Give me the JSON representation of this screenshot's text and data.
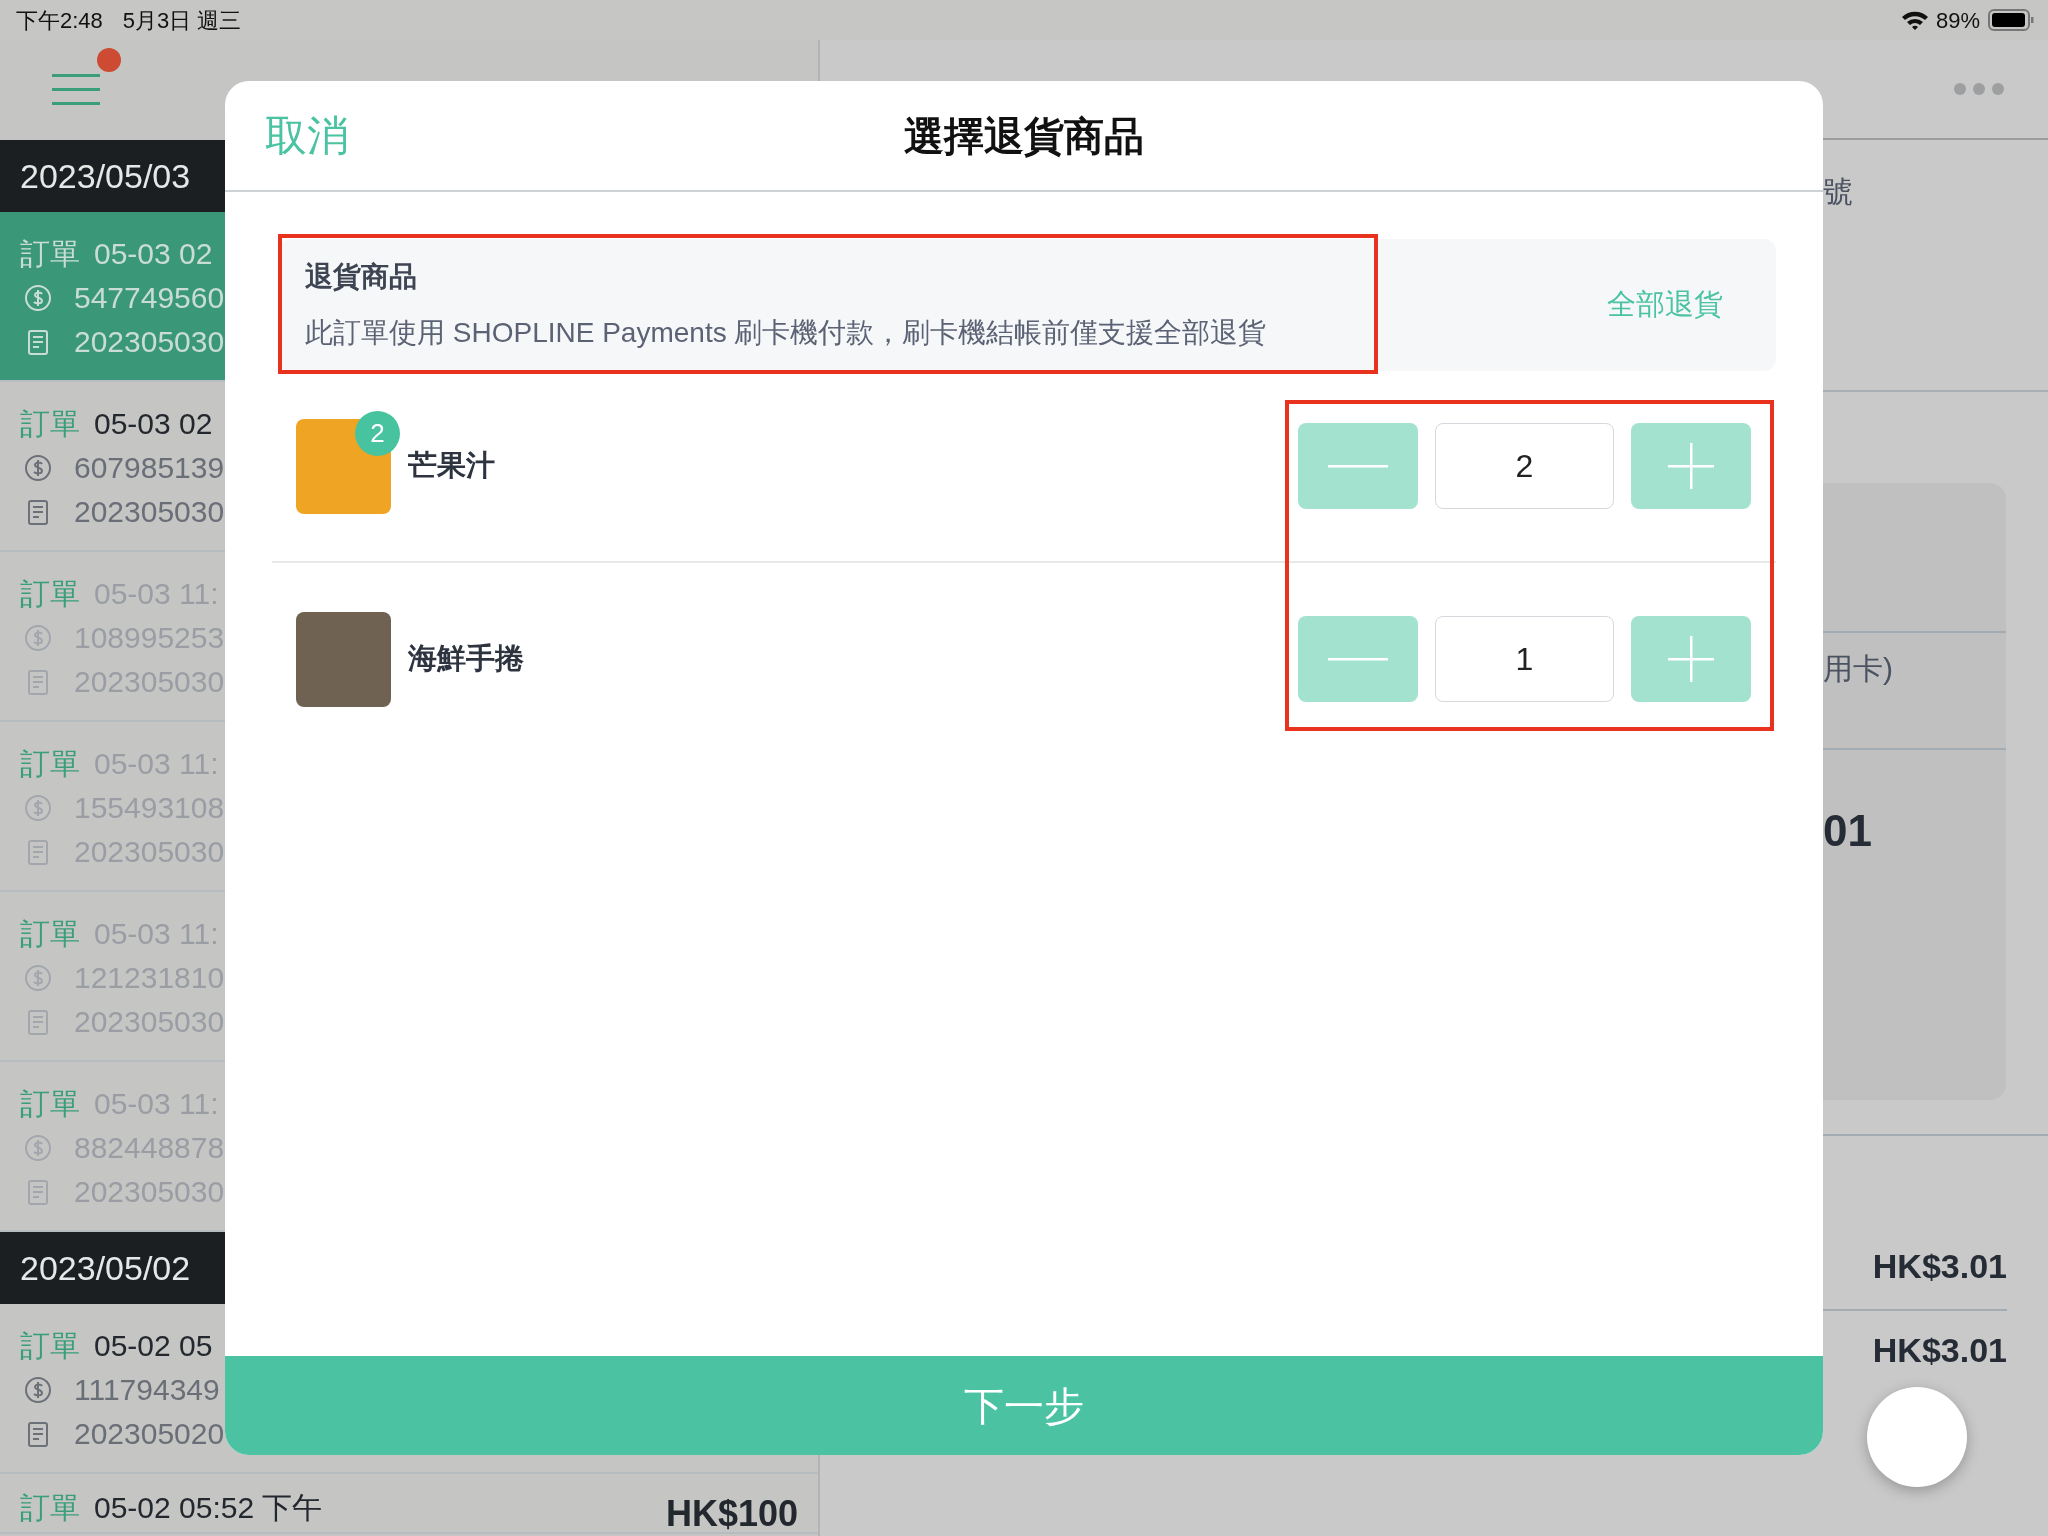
{
  "status_bar": {
    "time": "下午2:48",
    "date": "5月3日 週三",
    "battery": "89%"
  },
  "order_list": {
    "groups": [
      {
        "date": "2023/05/03",
        "orders": [
          {
            "label": "訂單",
            "time": "05-03 02",
            "payment_id": "547749560",
            "order_no": "202305030",
            "selected": true,
            "dimmed": false
          },
          {
            "label": "訂單",
            "time": "05-03 02",
            "payment_id": "607985139",
            "order_no": "202305030",
            "selected": false,
            "dimmed": false
          },
          {
            "label": "訂單",
            "time": "05-03 11:",
            "payment_id": "108995253",
            "order_no": "202305030",
            "selected": false,
            "dimmed": true
          },
          {
            "label": "訂單",
            "time": "05-03 11:",
            "payment_id": "155493108",
            "order_no": "202305030",
            "selected": false,
            "dimmed": true
          },
          {
            "label": "訂單",
            "time": "05-03 11:",
            "payment_id": "121231810",
            "order_no": "202305030",
            "selected": false,
            "dimmed": true
          },
          {
            "label": "訂單",
            "time": "05-03 11:",
            "payment_id": "882448878",
            "order_no": "202305030",
            "selected": false,
            "dimmed": true
          }
        ]
      },
      {
        "date": "2023/05/02",
        "orders": [
          {
            "label": "訂單",
            "time": "05-02 05",
            "payment_id": "111794349",
            "order_no": "202305020",
            "selected": false,
            "dimmed": false
          },
          {
            "label": "訂單",
            "time": "05-02 05:52 下午",
            "amount": "HK$100",
            "selected": false,
            "dimmed": false
          }
        ]
      }
    ]
  },
  "detail_pane": {
    "field_label": "號",
    "payment_method": "用卡)",
    "amount": "01",
    "totals": [
      "HK$3.01",
      "HK$3.01"
    ]
  },
  "dialog": {
    "cancel": "取消",
    "title": "選擇退貨商品",
    "notice": {
      "title": "退貨商品",
      "text": "此訂單使用 SHOPLINE Payments 刷卡機付款，刷卡機結帳前僅支援全部退貨",
      "action": "全部退貨"
    },
    "items": [
      {
        "name": "芒果汁",
        "badge": "2",
        "quantity": "2",
        "minus_disabled": true,
        "plus_disabled": true
      },
      {
        "name": "海鮮手捲",
        "quantity": "1",
        "minus_disabled": true,
        "plus_disabled": true
      }
    ],
    "next": "下一步"
  }
}
